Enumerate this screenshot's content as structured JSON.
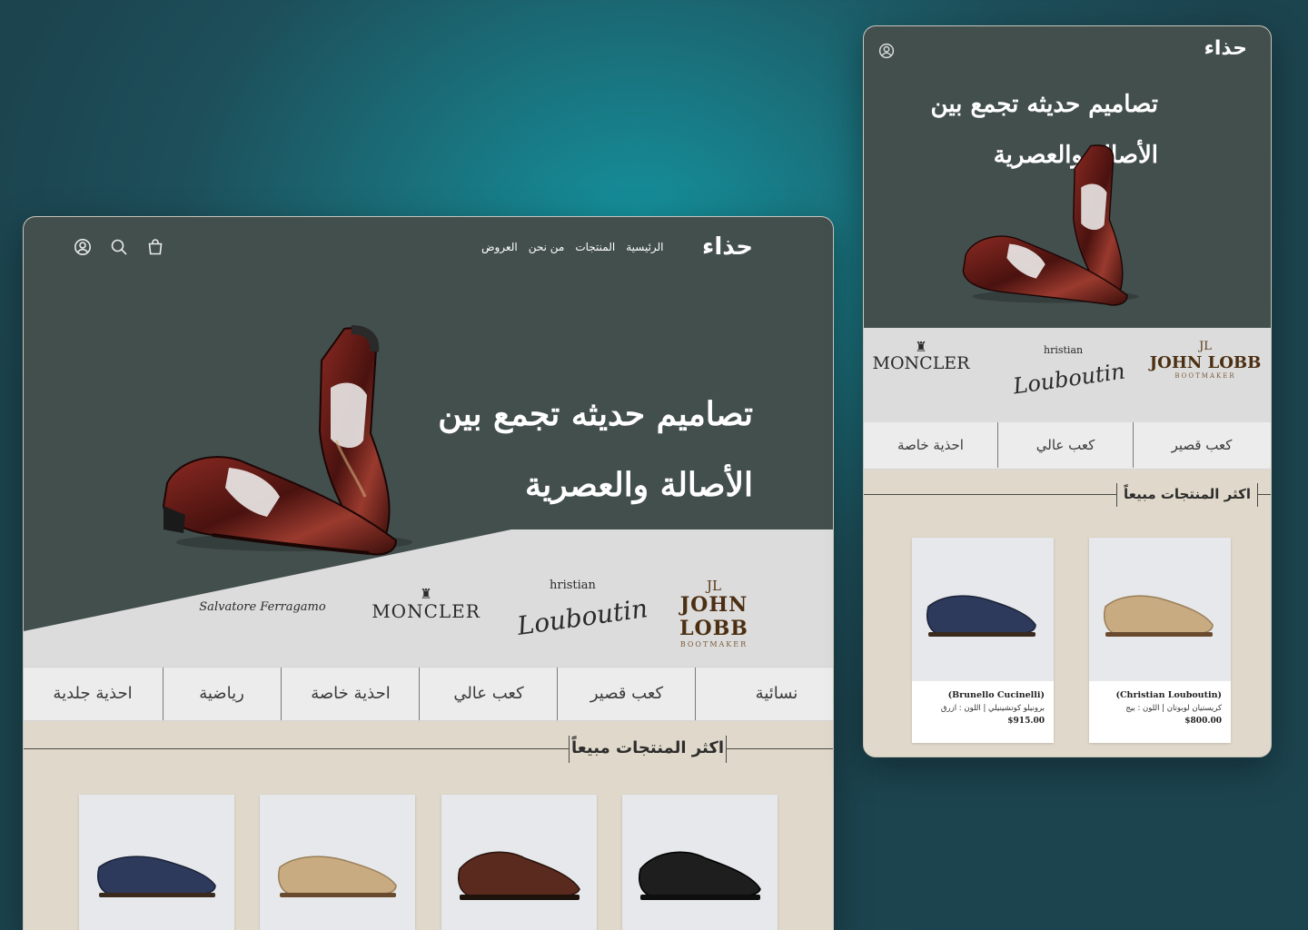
{
  "site": {
    "logo": "حذاء"
  },
  "desktop": {
    "nav": [
      {
        "label": "الرئيسية"
      },
      {
        "label": "المنتجات"
      },
      {
        "label": "من نحن"
      },
      {
        "label": "العروض"
      }
    ],
    "hero": {
      "line1": "تصاميم حديثه  تجمع بين",
      "line2": "الأصالة والعصرية"
    },
    "brands": {
      "johnlobb": {
        "main": "JOHN LOBB",
        "sub": "BOOTMAKER",
        "mark": "JL"
      },
      "louboutin": {
        "small": "hristian",
        "script": "Louboutin"
      },
      "moncler": {
        "main": "MONCLER"
      },
      "ferragamo": {
        "script": "Salvatore Ferragamo"
      }
    },
    "categories": [
      "نسائية",
      "كعب قصير",
      "كعب عالي",
      "احذية خاصة",
      "رياضية",
      "احذية جلدية"
    ],
    "section_title": "اكثر المنتجات مبيعاً"
  },
  "mobile": {
    "hero": {
      "line1": "تصاميم حديثه  تجمع بين",
      "line2": "الأصالة والعصرية"
    },
    "brands": {
      "moncler": "MONCLER",
      "louboutin_small": "hristian",
      "louboutin_script": "Louboutin",
      "johnlobb": "JOHN LOBB",
      "johnlobb_sub": "BOOTMAKER",
      "johnlobb_mark": "JL"
    },
    "categories": [
      "كعب قصير",
      "كعب عالي",
      "احذية خاصة"
    ],
    "section_title": "اكثر المنتجات مبيعاً",
    "products": [
      {
        "brand": "(Christian Louboutin)",
        "desc": "كريستيان لوبوتان | اللون : بيج",
        "price": "$800.00",
        "color": "#c9ab82"
      },
      {
        "brand": "(Brunello Cucinelli)",
        "desc": "برونيلو كوتشينيلي | اللون : ازرق",
        "price": "$915.00",
        "color": "#2e3a5c"
      }
    ]
  },
  "desktop_products": [
    {
      "color": "#2e3a5c"
    },
    {
      "color": "#c9ab82"
    },
    {
      "color": "#5a2a1e"
    },
    {
      "color": "#1e1e1e"
    }
  ],
  "colors": {
    "hero": "#434f4d",
    "cream": "#e0d9cb",
    "shoe": "#5e1b17"
  }
}
